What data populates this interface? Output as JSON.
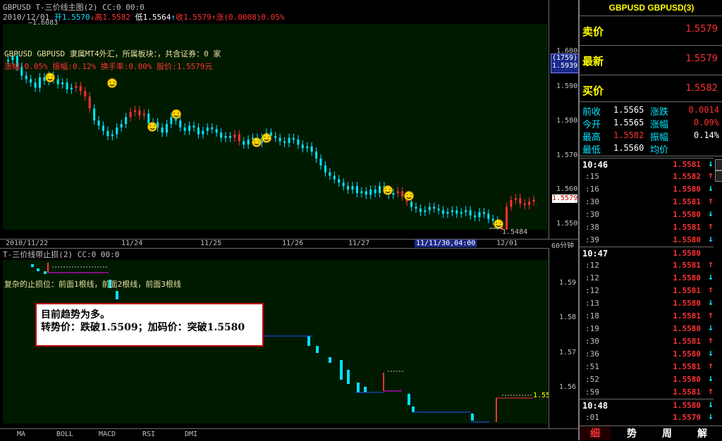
{
  "main_chart": {
    "title": "GBPUSD T-三价线主图(2) CC:0 00:0",
    "ohlc_line": {
      "date": "2010/12/01",
      "open_label": "开1.5570",
      "high_label": "高1.5582",
      "low_label": "低1.5564",
      "close_label": "收1.5579",
      "change_label": "涨(0.0008)0.05%"
    },
    "peak_label": "1.6083",
    "info_line1": "GBPUSD GBPUSD 隶属MT4外汇，所属板块：，共含证券：0 家",
    "info_line2": "涨幅:0.05% 振幅:0.12% 换手率:0.00% 股价:1.5579元",
    "low_marker": "1.5484",
    "y_ticks": [
      "1.6000",
      "1.5900",
      "1.5800",
      "1.5700",
      "1.5600",
      "1.5500"
    ],
    "badge_count": "(1759)",
    "badge_price": "1.5939",
    "current_price_tag": "1.5579",
    "period": "60分钟",
    "x_labels": [
      "2010/11/22",
      "11/24",
      "11/25",
      "11/26",
      "11/27",
      "11/11/30,04:00",
      "12/01"
    ]
  },
  "indicator_chart": {
    "title": "T-三价线带止损(2) CC:0 00:0",
    "desc": "复杂的止损位：前面1根线，前面2根线，前面3根线",
    "y_ticks": [
      "1.59",
      "1.58",
      "1.57",
      "1.56"
    ],
    "last_value": "1.55"
  },
  "info_box": {
    "line1": "目前趋势为多。",
    "line2": "转势价：跌破1.5509；加码价：突破1.5580"
  },
  "bottom_tabs": [
    "MA",
    "BOLL",
    "MACD",
    "RSI",
    "DMI"
  ],
  "quote_panel": {
    "title": "GBPUSD GBPUSD(3)",
    "ask_label": "卖价",
    "ask_value": "1.5579",
    "last_label": "最新",
    "last_value": "1.5579",
    "bid_label": "买价",
    "bid_value": "1.5582",
    "stats": [
      {
        "label": "前收",
        "value": "1.5565",
        "label2": "涨跌",
        "value2": "0.0014"
      },
      {
        "label": "今开",
        "value": "1.5565",
        "label2": "涨幅",
        "value2": "0.09%"
      },
      {
        "label": "最高",
        "value": "1.5582",
        "label2": "振幅",
        "value2": "0.14%"
      },
      {
        "label": "最低",
        "value": "1.5560",
        "label2": "均价",
        "value2": ""
      }
    ],
    "ticks": [
      {
        "time": "10:46",
        "price": "1.5581",
        "dir": "down",
        "big": true
      },
      {
        "time": ":15",
        "price": "1.5582",
        "dir": "up"
      },
      {
        "time": ":16",
        "price": "1.5580",
        "dir": "down"
      },
      {
        "time": ":30",
        "price": "1.5581",
        "dir": "up"
      },
      {
        "time": ":30",
        "price": "1.5580",
        "dir": "down"
      },
      {
        "time": ":38",
        "price": "1.5581",
        "dir": "up"
      },
      {
        "time": ":39",
        "price": "1.5580",
        "dir": "down"
      },
      {
        "time": "10:47",
        "price": "1.5580",
        "dir": "",
        "big": true
      },
      {
        "time": ":12",
        "price": "1.5581",
        "dir": "up"
      },
      {
        "time": ":12",
        "price": "1.5580",
        "dir": "down"
      },
      {
        "time": ":12",
        "price": "1.5581",
        "dir": "up"
      },
      {
        "time": ":13",
        "price": "1.5580",
        "dir": "down"
      },
      {
        "time": ":18",
        "price": "1.5581",
        "dir": "up"
      },
      {
        "time": ":19",
        "price": "1.5580",
        "dir": "down"
      },
      {
        "time": ":30",
        "price": "1.5581",
        "dir": "up"
      },
      {
        "time": ":36",
        "price": "1.5580",
        "dir": "down"
      },
      {
        "time": ":51",
        "price": "1.5581",
        "dir": "up"
      },
      {
        "time": ":52",
        "price": "1.5580",
        "dir": "down"
      },
      {
        "time": ":59",
        "price": "1.5581",
        "dir": "up"
      },
      {
        "time": "10:48",
        "price": "1.5580",
        "dir": "down",
        "big": true
      },
      {
        "time": ":01",
        "price": "1.5579",
        "dir": "down"
      }
    ],
    "tabs": [
      "细",
      "势",
      "周",
      "解"
    ]
  },
  "colors": {
    "up": "#ff3232",
    "down": "#00e5ff",
    "plot_bg": "#001a00",
    "accent_yellow": "#ffff00",
    "magenta": "#ff00ff"
  }
}
